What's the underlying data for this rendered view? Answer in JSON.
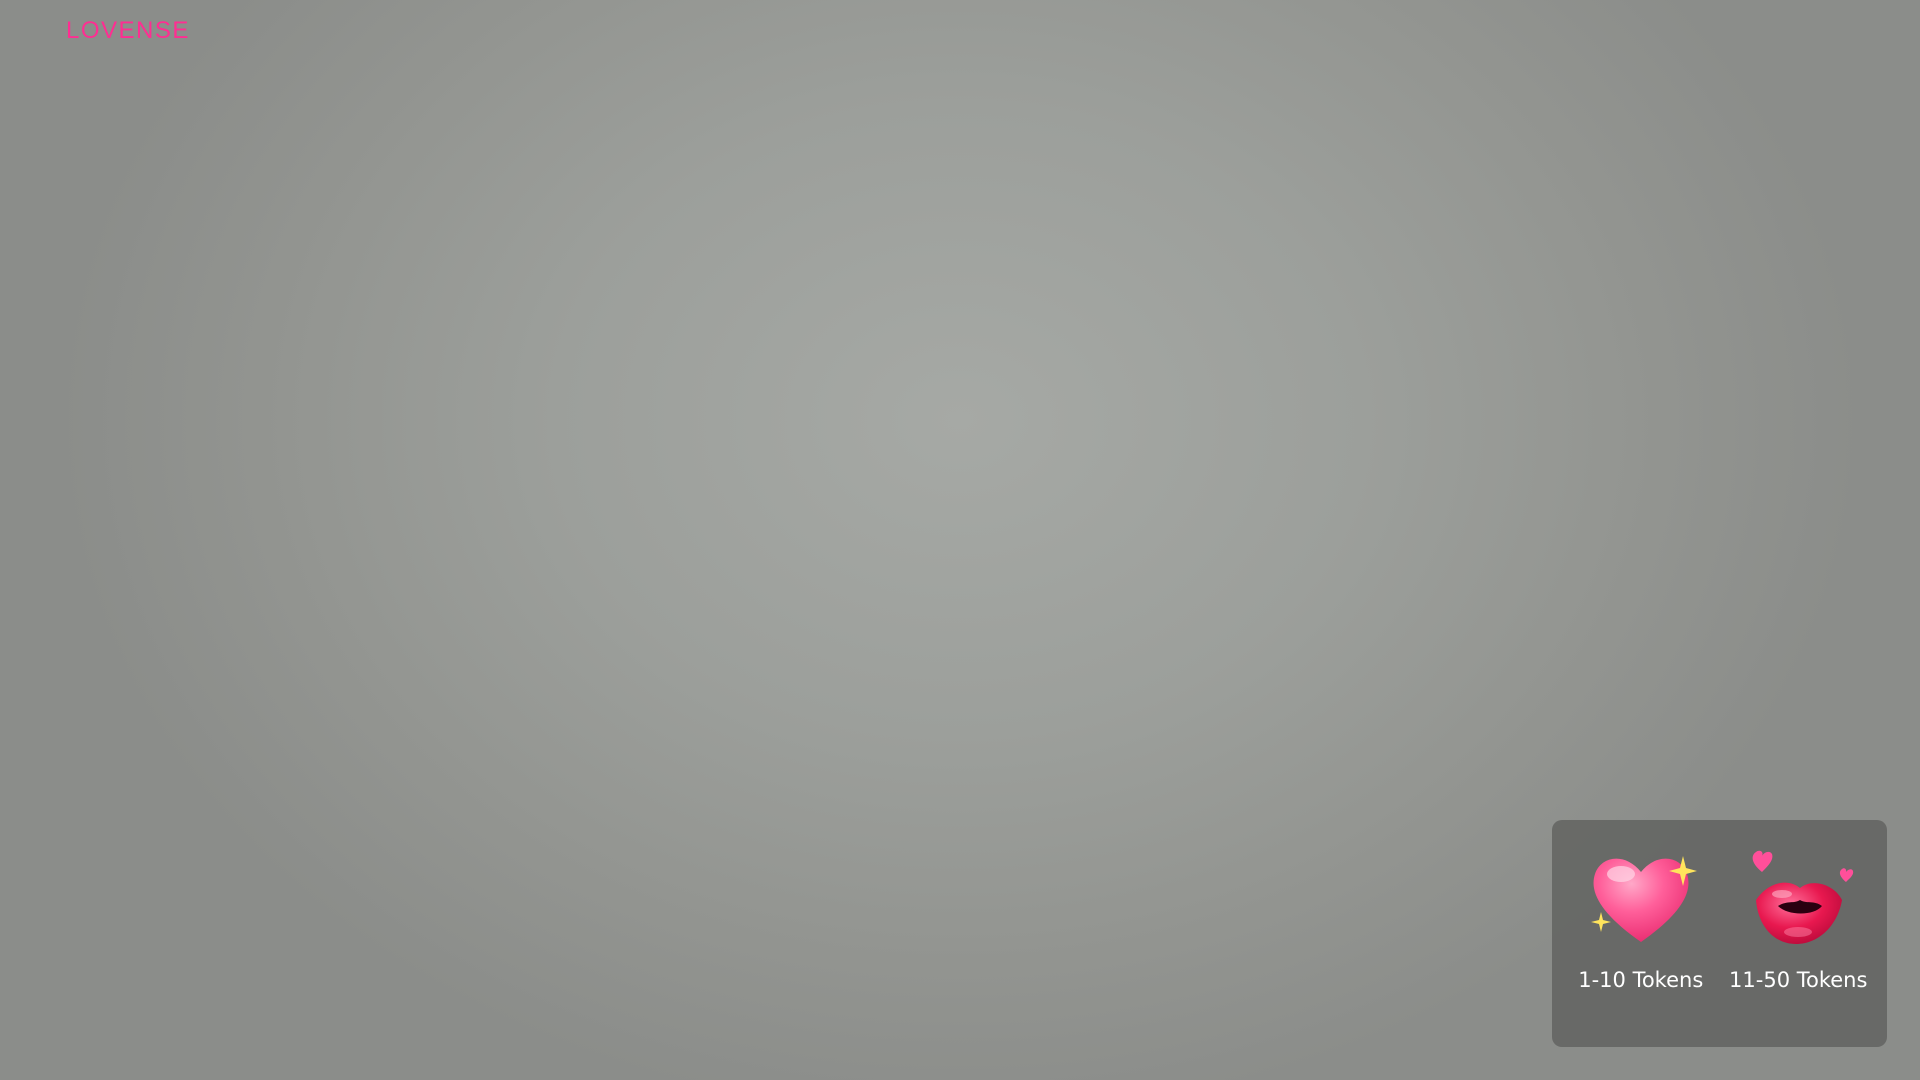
{
  "logo": {
    "text": "LOVENSE",
    "color": "#ff2d92"
  },
  "tip_levels": [
    {
      "icon": "heart-sparkle-icon",
      "label": "1-10 Tokens"
    },
    {
      "icon": "kiss-lips-icon",
      "label": "11-50 Tokens"
    }
  ],
  "colors": {
    "panel_bg": "#5c5e5b",
    "heart": "#ff4f8f",
    "lips": "#e0104f",
    "sparkle": "#ffe45c"
  }
}
